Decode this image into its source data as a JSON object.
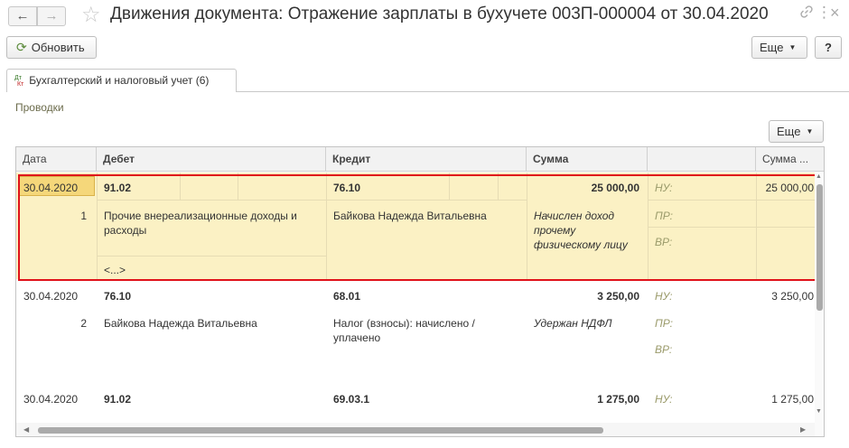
{
  "window": {
    "title": "Движения документа: Отражение зарплаты в бухучете 003П-000004 от 30.04.2020",
    "back_glyph": "←",
    "forward_glyph": "→",
    "star_glyph": "☆",
    "link_glyph": "🔗",
    "more_glyph": "⋮",
    "close_glyph": "×"
  },
  "toolbar": {
    "refresh_label": "Обновить",
    "refresh_icon": "⟳",
    "more_label": "Еще",
    "help_label": "?"
  },
  "tabs": [
    {
      "label": "Бухгалтерский и налоговый учет (6)",
      "icon": "dt-kt-icon",
      "icon_top": "Дт",
      "icon_bottom": "Кт"
    }
  ],
  "section": {
    "label": "Проводки",
    "more_label": "Еще"
  },
  "grid": {
    "columns": [
      "Дата",
      "Дебет",
      "Кредит",
      "Сумма",
      "",
      "Сумма ..."
    ],
    "rows": [
      {
        "date": "30.04.2020",
        "number": "1",
        "debit_account": "91.02",
        "debit_name": "Прочие внереализационные доходы и расходы",
        "debit_extra": "<...>",
        "credit_account": "76.10",
        "credit_name": "Байкова Надежда Витальевна",
        "amount": "25 000,00",
        "content": "Начислен доход прочему физическому лицу",
        "nu_label": "НУ:",
        "pr_label": "ПР:",
        "vr_label": "ВР:",
        "amount2": "25 000,00"
      },
      {
        "date": "30.04.2020",
        "number": "2",
        "debit_account": "76.10",
        "debit_name": "Байкова Надежда Витальевна",
        "credit_account": "68.01",
        "credit_name": "Налог (взносы): начислено / уплачено",
        "amount": "3 250,00",
        "content": "Удержан НДФЛ",
        "nu_label": "НУ:",
        "pr_label": "ПР:",
        "vr_label": "ВР:",
        "amount2": "3 250,00"
      },
      {
        "date": "30.04.2020",
        "debit_account": "91.02",
        "credit_account": "69.03.1",
        "amount": "1 275,00",
        "nu_label": "НУ:",
        "amount2": "1 275,00"
      }
    ]
  },
  "colors": {
    "selected_row": "#fbf1c4",
    "selected_cell": "#f5d77a",
    "highlight_frame": "#e0121a"
  }
}
